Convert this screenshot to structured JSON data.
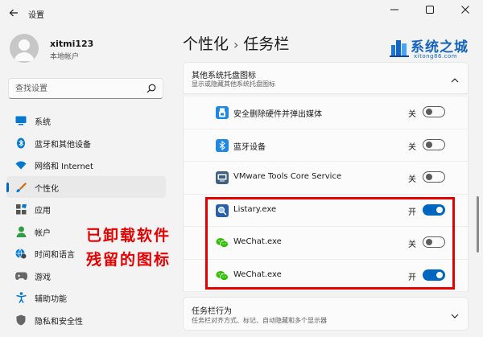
{
  "window": {
    "title": "设置"
  },
  "user": {
    "name": "xitmi123",
    "account_type": "本地帐户"
  },
  "search": {
    "placeholder": "查找设置"
  },
  "sidebar": {
    "items": [
      {
        "label": "系统",
        "icon": "monitor-icon",
        "color": "#0078d4"
      },
      {
        "label": "蓝牙和其他设备",
        "icon": "bluetooth-icon",
        "color": "#0078d4"
      },
      {
        "label": "网络和 Internet",
        "icon": "wifi-icon",
        "color": "#0078d4"
      },
      {
        "label": "个性化",
        "icon": "brush-icon",
        "color": "#d46a00",
        "active": true
      },
      {
        "label": "应用",
        "icon": "apps-icon",
        "color": "#555555"
      },
      {
        "label": "帐户",
        "icon": "person-icon",
        "color": "#2ea043"
      },
      {
        "label": "时间和语言",
        "icon": "globe-clock-icon",
        "color": "#0078d4"
      },
      {
        "label": "游戏",
        "icon": "gamepad-icon",
        "color": "#666666"
      },
      {
        "label": "辅助功能",
        "icon": "accessibility-icon",
        "color": "#0078d4"
      },
      {
        "label": "隐私和安全性",
        "icon": "shield-icon",
        "color": "#666666"
      }
    ]
  },
  "breadcrumb": {
    "parent": "个性化",
    "separator": "›",
    "current": "任务栏"
  },
  "logo": {
    "text": "系统之城",
    "url": "xitong86.com"
  },
  "tray_section": {
    "title": "其他系统托盘图标",
    "subtitle": "显示或隐藏其他系统托盘图标",
    "rows": [
      {
        "label": "安全删除硬件并弹出媒体",
        "state": "关",
        "on": false,
        "icon": "usb-eject-icon"
      },
      {
        "label": "蓝牙设备",
        "state": "关",
        "on": false,
        "icon": "bluetooth-icon"
      },
      {
        "label": "VMware Tools Core Service",
        "state": "关",
        "on": false,
        "icon": "vmware-icon"
      },
      {
        "label": "Listary.exe",
        "state": "开",
        "on": true,
        "icon": "listary-icon"
      },
      {
        "label": "WeChat.exe",
        "state": "关",
        "on": false,
        "icon": "wechat-icon"
      },
      {
        "label": "WeChat.exe",
        "state": "开",
        "on": true,
        "icon": "wechat-icon"
      }
    ]
  },
  "behavior_section": {
    "title": "任务栏行为",
    "subtitle": "任务栏对齐方式、标记、自动隐藏和多个显示器"
  },
  "annotation": {
    "line1": "已卸载软件",
    "line2": "残留的图标",
    "color": "#e60000"
  },
  "colors": {
    "accent": "#0067c0",
    "annotation_red": "#e60000"
  }
}
